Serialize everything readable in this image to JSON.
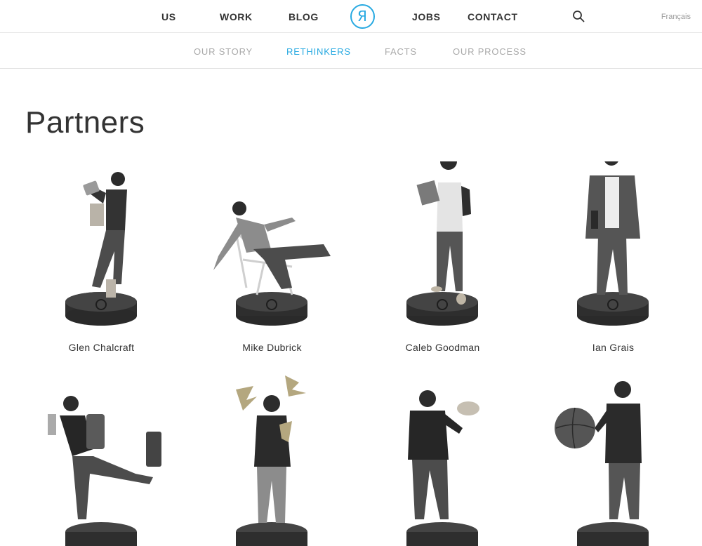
{
  "nav": {
    "items": [
      {
        "label": "US"
      },
      {
        "label": "WORK"
      },
      {
        "label": "BLOG"
      },
      {
        "label": "JOBS"
      },
      {
        "label": "CONTACT"
      }
    ],
    "logo_glyph": "Я",
    "language": "Français"
  },
  "subnav": {
    "items": [
      {
        "label": "OUR STORY"
      },
      {
        "label": "RETHINKERS",
        "active": true
      },
      {
        "label": "FACTS"
      },
      {
        "label": "OUR PROCESS"
      }
    ]
  },
  "page": {
    "title": "Partners"
  },
  "people": [
    {
      "name": "Glen Chalcraft"
    },
    {
      "name": "Mike Dubrick"
    },
    {
      "name": "Caleb Goodman"
    },
    {
      "name": "Ian Grais"
    },
    {
      "name": ""
    },
    {
      "name": ""
    },
    {
      "name": ""
    },
    {
      "name": ""
    }
  ],
  "colors": {
    "accent": "#27a9e1",
    "text": "#333333",
    "muted": "#a9a9a9"
  }
}
